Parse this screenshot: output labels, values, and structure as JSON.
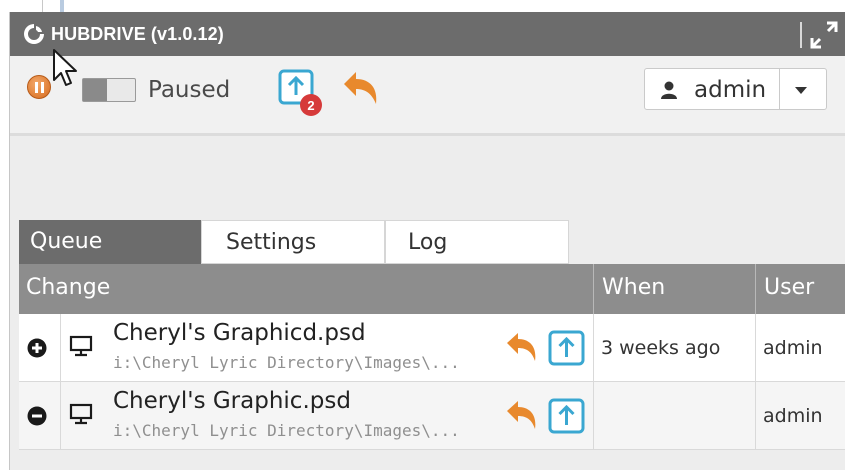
{
  "window": {
    "title": "HUBDRIVE (v1.0.12)",
    "icons": [
      "hubdrive-logo-icon",
      "resize-icon"
    ]
  },
  "toolbar": {
    "status_label": "Paused",
    "upload_badge_count": "2",
    "user_name": "admin",
    "icons": [
      "pause-icon",
      "toggle-switch",
      "upload-icon",
      "undo-icon",
      "user-icon",
      "caret-down-icon"
    ],
    "accent_color": "#e8892d",
    "upload_color": "#3aa7d1",
    "badge_color": "#d63a3a"
  },
  "tabs": [
    {
      "label": "Queue",
      "active": true
    },
    {
      "label": "Settings",
      "active": false
    },
    {
      "label": "Log",
      "active": false
    }
  ],
  "table": {
    "columns": [
      "Change",
      "When",
      "User"
    ],
    "rows": [
      {
        "action": "add-icon",
        "name": "Cheryl's Graphicd.psd",
        "path": "i:\\Cheryl Lyric Directory\\Images\\...",
        "when": "3 weeks ago",
        "user": "admin"
      },
      {
        "action": "remove-icon",
        "name": "Cheryl's Graphic.psd",
        "path": "i:\\Cheryl Lyric Directory\\Images\\...",
        "when": "",
        "user": "admin"
      }
    ]
  }
}
